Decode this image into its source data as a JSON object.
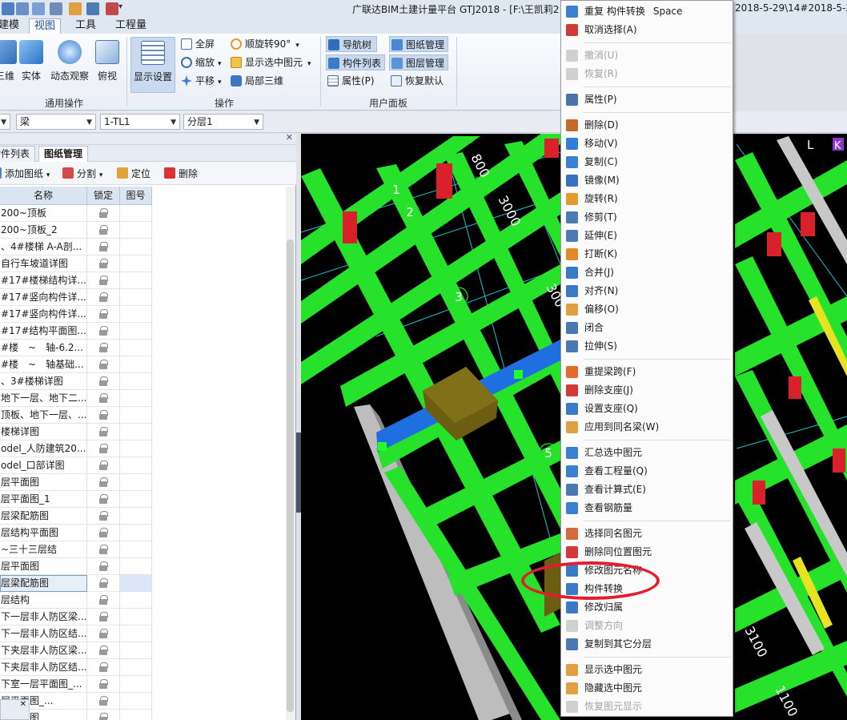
{
  "window": {
    "title": "广联达BIM土建计量平台 GTJ2018 - [F:\\王凯莉2",
    "title_tail": "2018-5-29\\14#2018-5-2"
  },
  "menu_tabs": [
    {
      "label": "建模"
    },
    {
      "label": "视图"
    },
    {
      "label": "工具"
    },
    {
      "label": "工程量"
    }
  ],
  "ribbon": {
    "groups": {
      "common_ops": {
        "label": "通用操作",
        "buttons": [
          "三维",
          "实体",
          "动态观察",
          "俯视"
        ]
      },
      "operations": {
        "label": "操作",
        "display_setting": "显示设置",
        "fullscreen": "全屏",
        "zoom": "缩放",
        "pan": "平移",
        "rotate": "顺旋转90°",
        "show_selected": "显示选中图元",
        "local_3d": "局部三维"
      },
      "user_panel": {
        "label": "用户面板",
        "nav_tree": "导航树",
        "drawing_mgmt": "图纸管理",
        "component_list": "构件列表",
        "layer_mgmt": "图层管理",
        "properties": "属性(P)",
        "restore_default": "恢复默认"
      }
    }
  },
  "filters": {
    "type": "梁",
    "component": "1-TL1",
    "layer": "分层1"
  },
  "left_panel": {
    "tabs": [
      "构件列表",
      "图纸管理"
    ],
    "active_tab": "图纸管理",
    "tools": {
      "add_drawing": "添加图纸",
      "split": "分割",
      "locate": "定位",
      "delete": "删除"
    },
    "columns": [
      "名称",
      "锁定",
      "图号"
    ],
    "rows": [
      "200~顶板",
      "200~顶板_2",
      "、4#楼梯 A-A剖...",
      "自行车坡道详图",
      "#17#楼梯结构详...",
      "#17#竖向构件详...",
      "#17#竖向构件详...",
      "#17#结构平面图...",
      "#楼　~　轴-6.2...",
      "#楼　~　轴基础...",
      "、3#楼梯详图",
      "地下一层、地下二...",
      "顶板、地下一层、...",
      "楼梯详图",
      "odel_人防建筑20...",
      "odel_口部详图",
      "层平面图",
      "层平面图_1",
      "层梁配筋图",
      "层结构平面图",
      "~三十三层结",
      "层平面图",
      "层梁配筋图",
      "层结构",
      "下一层非人防区梁...",
      "下一层非人防区结...",
      "下夹层非人防区梁...",
      "下夹层非人防区结...",
      "下室一层平面图_...",
      "层平面图_...",
      "层平面图"
    ],
    "selected_index": 22
  },
  "viewport": {
    "axis_labels": [
      "1",
      "2",
      "3",
      "5"
    ],
    "dims": [
      "800",
      "3000",
      "300",
      "3100",
      "1100"
    ],
    "corner_tags": [
      "L",
      "K"
    ]
  },
  "context_menu": {
    "items": [
      {
        "label": "重复 构件转换",
        "shortcut": "Space",
        "icon": "repeat-icon",
        "disabled": false
      },
      {
        "label": "取消选择(A)",
        "icon": "deselect-icon",
        "disabled": false
      },
      {
        "sep": true
      },
      {
        "label": "撤消(U)",
        "icon": "undo-icon",
        "disabled": true
      },
      {
        "label": "恢复(R)",
        "icon": "redo-icon",
        "disabled": true
      },
      {
        "sep": true
      },
      {
        "label": "属性(P)",
        "icon": "properties-icon",
        "disabled": false
      },
      {
        "sep": true
      },
      {
        "label": "删除(D)",
        "icon": "delete-icon",
        "disabled": false
      },
      {
        "label": "移动(V)",
        "icon": "move-icon",
        "disabled": false
      },
      {
        "label": "复制(C)",
        "icon": "copy-icon",
        "disabled": false
      },
      {
        "label": "镜像(M)",
        "icon": "mirror-icon",
        "disabled": false
      },
      {
        "label": "旋转(R)",
        "icon": "rotate-icon",
        "disabled": false
      },
      {
        "label": "修剪(T)",
        "icon": "trim-icon",
        "disabled": false
      },
      {
        "label": "延伸(E)",
        "icon": "extend-icon",
        "disabled": false
      },
      {
        "label": "打断(K)",
        "icon": "break-icon",
        "disabled": false
      },
      {
        "label": "合并(J)",
        "icon": "merge-icon",
        "disabled": false
      },
      {
        "label": "对齐(N)",
        "icon": "align-icon",
        "disabled": false
      },
      {
        "label": "偏移(O)",
        "icon": "offset-icon",
        "disabled": false
      },
      {
        "label": "闭合",
        "icon": "close-shape-icon",
        "disabled": false
      },
      {
        "label": "拉伸(S)",
        "icon": "stretch-icon",
        "disabled": false
      },
      {
        "sep": true
      },
      {
        "label": "重提梁跨(F)",
        "icon": "beam-span-icon",
        "disabled": false
      },
      {
        "label": "删除支座(J)",
        "icon": "delete-support-icon",
        "disabled": false
      },
      {
        "label": "设置支座(Q)",
        "icon": "set-support-icon",
        "disabled": false
      },
      {
        "label": "应用到同名梁(W)",
        "icon": "apply-same-beam-icon",
        "disabled": false
      },
      {
        "sep": true
      },
      {
        "label": "汇总选中图元",
        "icon": "sum-icon",
        "disabled": false
      },
      {
        "label": "查看工程量(Q)",
        "icon": "quantity-icon",
        "disabled": false
      },
      {
        "label": "查看计算式(E)",
        "icon": "formula-icon",
        "disabled": false
      },
      {
        "label": "查看钢筋量",
        "icon": "rebar-icon",
        "disabled": false
      },
      {
        "sep": true
      },
      {
        "label": "选择同名图元",
        "icon": "select-same-icon",
        "disabled": false
      },
      {
        "label": "删除同位置图元",
        "icon": "delete-same-pos-icon",
        "disabled": false
      },
      {
        "label": "修改图元名称",
        "icon": "rename-icon",
        "disabled": false
      },
      {
        "label": "构件转换",
        "icon": "convert-icon",
        "disabled": false
      },
      {
        "label": "修改归属",
        "icon": "owner-icon",
        "disabled": false
      },
      {
        "label": "调整方向",
        "icon": "direction-icon",
        "disabled": true
      },
      {
        "label": "复制到其它分层",
        "icon": "copy-layer-icon",
        "disabled": false
      },
      {
        "sep": true
      },
      {
        "label": "显示选中图元",
        "icon": "show-selected-icon",
        "disabled": false
      },
      {
        "label": "隐藏选中图元",
        "icon": "hide-selected-icon",
        "disabled": false
      },
      {
        "label": "恢复图元显示",
        "icon": "restore-display-icon",
        "disabled": true
      }
    ]
  },
  "colors": {
    "beam_green": "#27e22a",
    "beam_blue": "#1f6fe0",
    "column_red": "#d8212a",
    "wall_gray": "#bfbfbf",
    "annotation_red": "#e51c2d"
  }
}
